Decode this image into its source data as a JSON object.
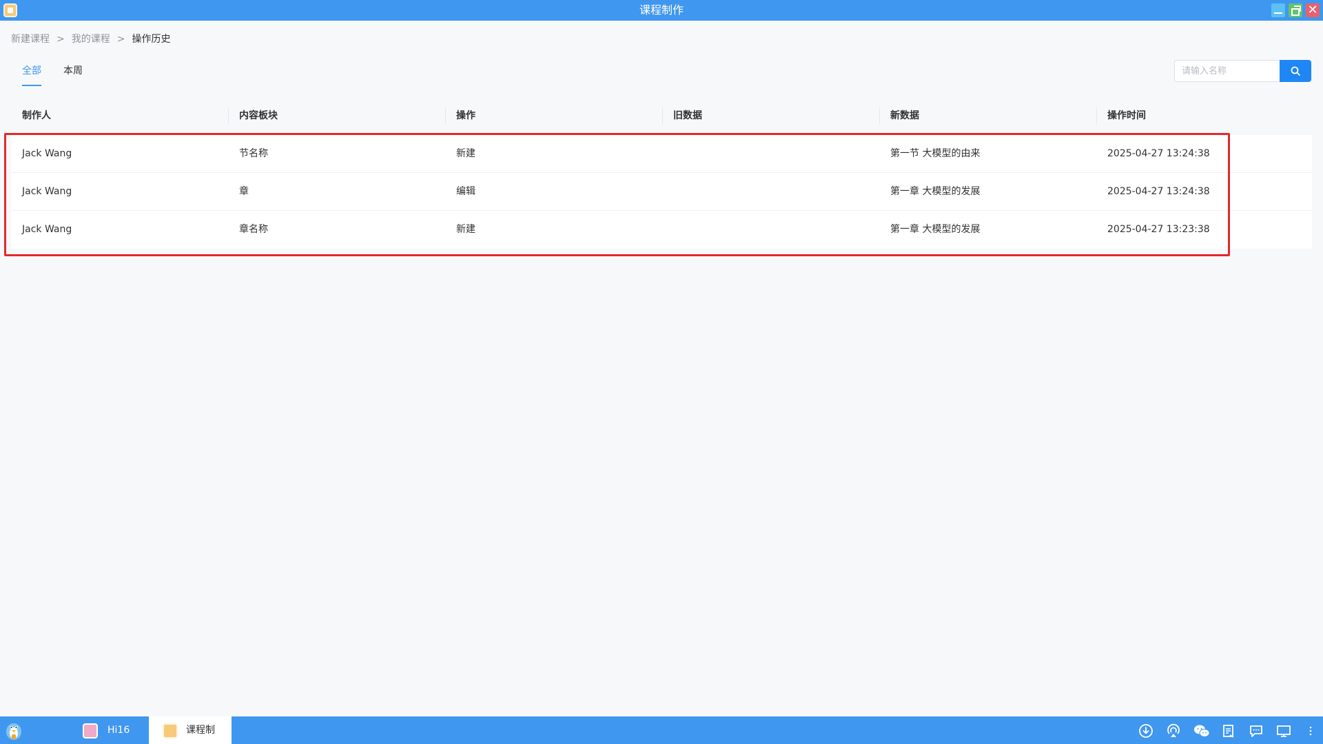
{
  "window": {
    "title": "课程制作"
  },
  "breadcrumb": [
    "新建课程",
    "我的课程",
    "操作历史"
  ],
  "breadcrumb_separator": ">",
  "tabs": [
    "全部",
    "本周"
  ],
  "active_tab": "全部",
  "search": {
    "placeholder": "请输入名称",
    "value": ""
  },
  "table": {
    "columns": [
      "制作人",
      "内容板块",
      "操作",
      "旧数据",
      "新数据",
      "操作时间"
    ],
    "rows": [
      [
        "Jack Wang",
        "节名称",
        "新建",
        "",
        "第一节 大模型的由来",
        "2025-04-27 13:24:38"
      ],
      [
        "Jack Wang",
        "章",
        "编辑",
        "",
        "第一章 大模型的发展",
        "2025-04-27 13:24:38"
      ],
      [
        "Jack Wang",
        "章名称",
        "新建",
        "",
        "第一章 大模型的发展",
        "2025-04-27 13:23:38"
      ]
    ]
  },
  "taskbar": {
    "tasks": [
      "Hi16",
      "课程制"
    ],
    "tray_icons": [
      "download-icon",
      "airplay-icon",
      "wechat-icon",
      "document-icon",
      "chat-icon",
      "display-icon",
      "more-icon"
    ]
  },
  "colors": {
    "accent": "#3f97f0",
    "search_button": "#1f86f5",
    "highlight": "#e5282a"
  }
}
